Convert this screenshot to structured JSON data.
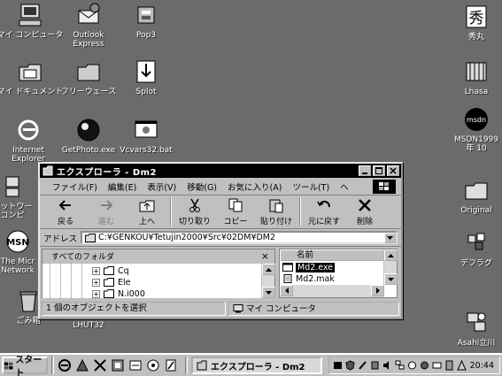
{
  "desktop": {
    "icons_left": [
      {
        "label": "マイ コンピュータ",
        "icon": "my-computer-icon"
      },
      {
        "label": "Outlook\nExpress",
        "icon": "outlook-express-icon"
      },
      {
        "label": "Pop3",
        "icon": "pop3-icon"
      },
      {
        "label": "マイ ドキュメント",
        "icon": "my-documents-icon"
      },
      {
        "label": "フリーウェース",
        "icon": "freeware-folder-icon"
      },
      {
        "label": "Splot",
        "icon": "splot-icon"
      },
      {
        "label": "Internet\nExplorer",
        "icon": "internet-explorer-icon"
      },
      {
        "label": "GetPhoto.exe",
        "icon": "getphoto-icon"
      },
      {
        "label": "Vcvars32.bat",
        "icon": "vcvars-icon"
      },
      {
        "label": "ネットワー\nコンピ",
        "icon": "network-icon"
      },
      {
        "label": "The Micr\nNetwork",
        "icon": "msn-icon"
      },
      {
        "label": "ごみ箱",
        "icon": "recycle-bin-icon"
      },
      {
        "label": "LHUT32",
        "icon": "lhut32-icon"
      }
    ],
    "icons_right": [
      {
        "label": "秀丸",
        "icon": "hidemaru-icon"
      },
      {
        "label": "Lhasa",
        "icon": "lhasa-icon"
      },
      {
        "label": "MSDN1999\n年 10",
        "icon": "msdn-icon"
      },
      {
        "label": "Original",
        "icon": "original-folder-icon"
      },
      {
        "label": "デフラグ",
        "icon": "defrag-icon"
      },
      {
        "label": "Asahi立川",
        "icon": "asahi-icon"
      }
    ]
  },
  "explorer": {
    "title": "エクスプローラ  - Dm2",
    "menu": [
      "ファイル(F)",
      "編集(E)",
      "表示(V)",
      "移動(G)",
      "お気に入り(A)",
      "ツール(T)",
      "ヘ"
    ],
    "toolbar": [
      {
        "label": "戻る",
        "icon": "back-arrow-icon",
        "enabled": true
      },
      {
        "label": "進む",
        "icon": "forward-arrow-icon",
        "enabled": false
      },
      {
        "label": "上へ",
        "icon": "up-folder-icon",
        "enabled": true
      },
      {
        "label": "切り取り",
        "icon": "scissors-icon",
        "enabled": true
      },
      {
        "label": "コピー",
        "icon": "copy-icon",
        "enabled": true
      },
      {
        "label": "貼り付け",
        "icon": "paste-icon",
        "enabled": true
      },
      {
        "label": "元に戻す",
        "icon": "undo-icon",
        "enabled": true
      },
      {
        "label": "削除",
        "icon": "delete-icon",
        "enabled": true
      }
    ],
    "address_label": "アドレス",
    "address_value": "C:¥GENKOU¥Tetujin2000¥Src¥02DM¥DM2",
    "folders_pane_title": "すべてのフォルダ",
    "folders_close": "×",
    "tree": [
      {
        "name": "Cq"
      },
      {
        "name": "Ele"
      },
      {
        "name": "N.i000"
      }
    ],
    "files_column": "名前",
    "files": [
      {
        "name": "Md2.exe",
        "selected": true
      },
      {
        "name": "Md2.mak",
        "selected": false
      }
    ],
    "status_left": "1 個のオブジェクトを選択",
    "status_right": "マイ コンピュータ"
  },
  "taskbar": {
    "start_label": "スタート",
    "task_button": "エクスプローラ  - Dm2",
    "clock": "20:44"
  }
}
